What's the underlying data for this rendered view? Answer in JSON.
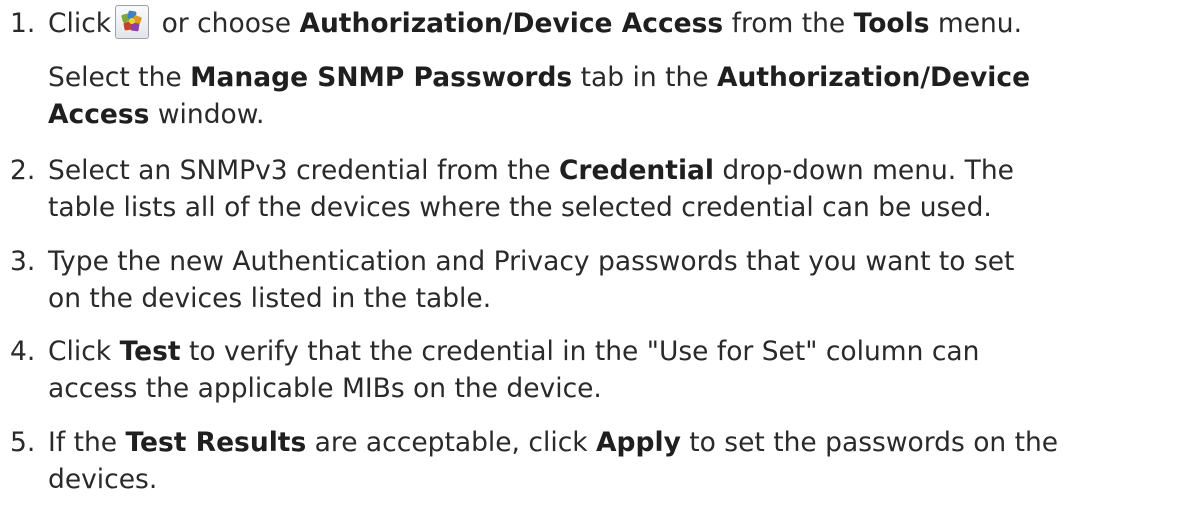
{
  "steps": [
    {
      "number": "1.",
      "line1": {
        "t1": "Click",
        "icon": "authorization-device-access-icon",
        "t2": " or choose ",
        "b1": "Authorization/Device Access",
        "t3": " from the ",
        "b2": "Tools",
        "t4": " menu."
      },
      "line2": {
        "t1": "Select the ",
        "b1": "Manage SNMP Passwords",
        "t2": " tab in the ",
        "b2": "Authorization/Device"
      },
      "line3": {
        "b1": "Access",
        "t1": " window."
      }
    },
    {
      "number": "2.",
      "line1": {
        "t1": "Select an SNMPv3 credential from the ",
        "b1": "Credential",
        "t2": " drop-down menu. The"
      },
      "line2": "table lists all of the devices where the selected credential can be used."
    },
    {
      "number": "3.",
      "line1": "Type the new Authentication and Privacy passwords that you want to set",
      "line2": "on the devices listed in the table."
    },
    {
      "number": "4.",
      "line1": {
        "t1": "Click ",
        "b1": "Test",
        "t2": " to verify that the credential in the \"Use for Set\" column can"
      },
      "line2": "access the applicable MIBs on the device."
    },
    {
      "number": "5.",
      "line1": {
        "t1": "If the ",
        "b1": "Test Results",
        "t2": " are acceptable, click ",
        "b2": "Apply",
        "t3": " to set the passwords on the"
      },
      "line2": "devices."
    }
  ]
}
